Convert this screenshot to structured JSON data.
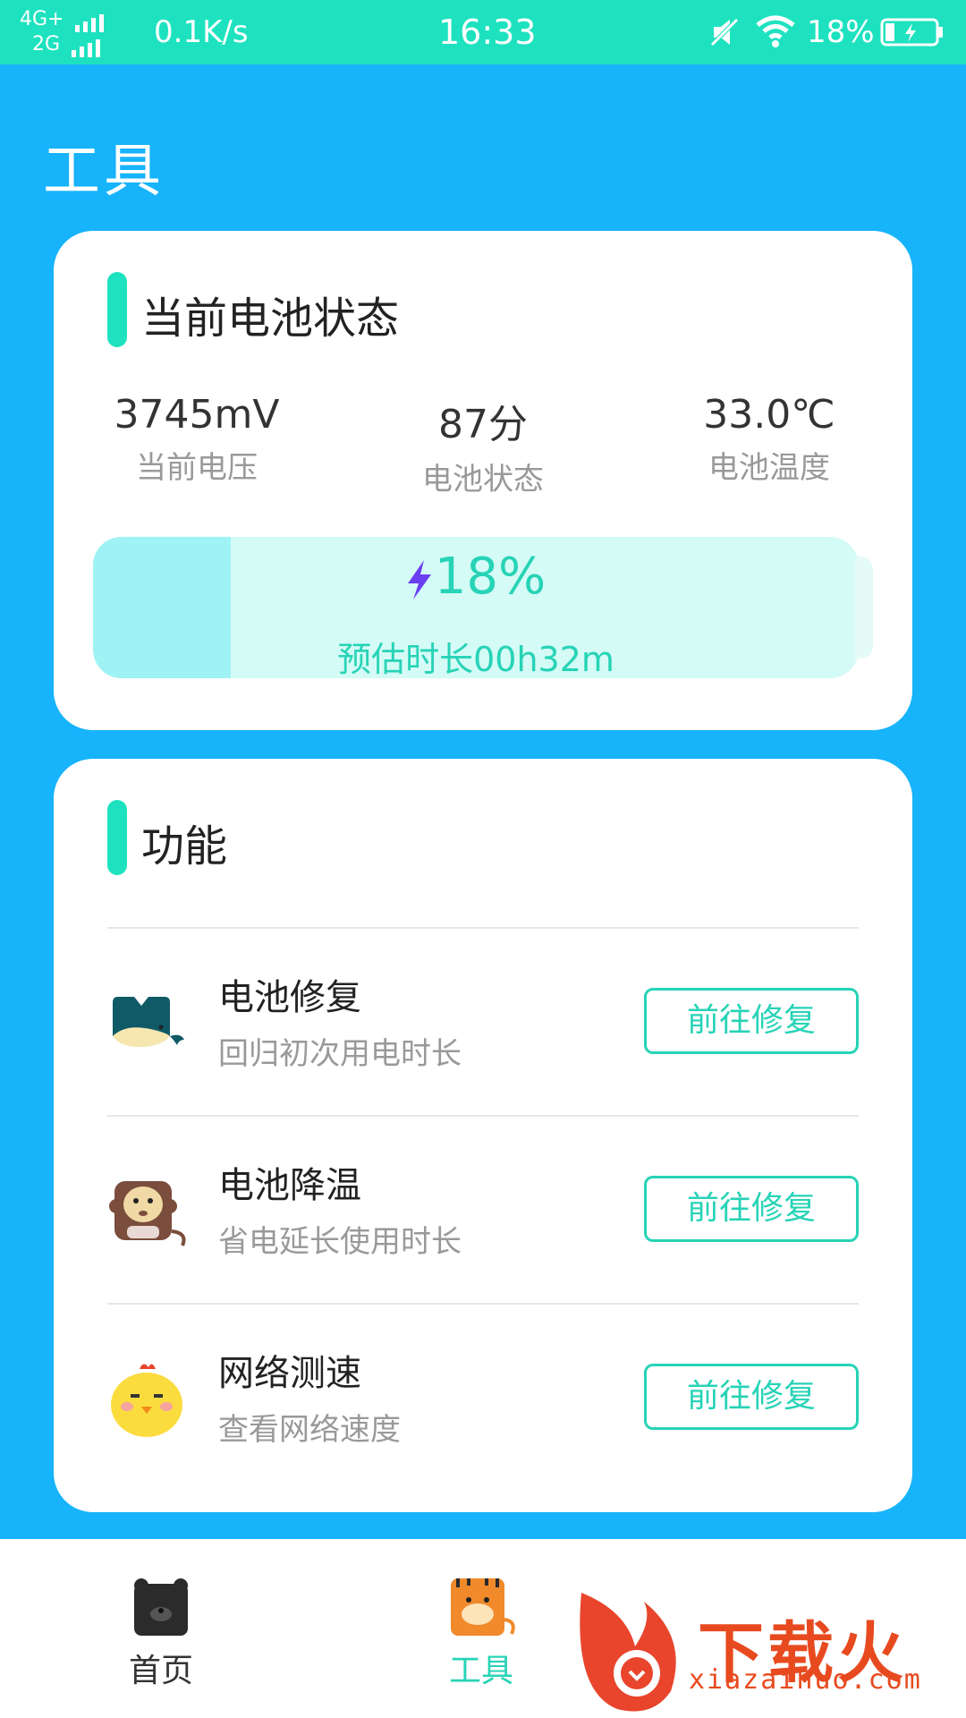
{
  "status_bar": {
    "net_type_1": "4G+",
    "net_type_2": "2G",
    "speed": "0.1K/s",
    "time": "16:33",
    "battery": "18%"
  },
  "page": {
    "title": "工具"
  },
  "battery_card": {
    "title": "当前电池状态",
    "stats": [
      {
        "value": "3745mV",
        "label": "当前电压"
      },
      {
        "value": "87分",
        "label": "电池状态"
      },
      {
        "value": "33.0℃",
        "label": "电池温度"
      }
    ],
    "level_text": "18%",
    "level_fraction": 0.18,
    "estimate": "预估时长00h32m"
  },
  "func_card": {
    "title": "功能",
    "items": [
      {
        "icon": "whale-icon",
        "name": "电池修复",
        "desc": "回归初次用电时长",
        "button": "前往修复"
      },
      {
        "icon": "monkey-icon",
        "name": "电池降温",
        "desc": "省电延长使用时长",
        "button": "前往修复"
      },
      {
        "icon": "chick-icon",
        "name": "网络测速",
        "desc": "查看网络速度",
        "button": "前往修复"
      }
    ]
  },
  "bottom_nav": {
    "items": [
      {
        "label": "首页",
        "icon": "bear-icon",
        "active": false
      },
      {
        "label": "工具",
        "icon": "tiger-icon",
        "active": true
      }
    ],
    "active_color": "#27d3b6"
  },
  "watermark": {
    "brand": "下载火",
    "domain": "xiazaihuo.com"
  },
  "colors": {
    "accent": "#1ee2bf",
    "background": "#17b3fb"
  }
}
